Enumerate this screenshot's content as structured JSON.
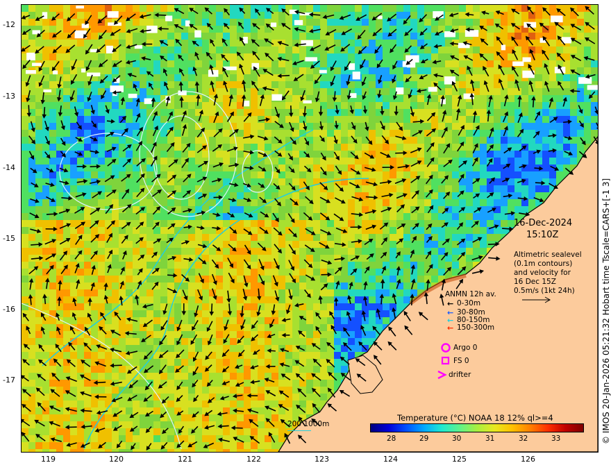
{
  "map": {
    "y_axis_labels": [
      "-12",
      "-13",
      "-14",
      "-15",
      "-16",
      "-17"
    ],
    "x_axis_labels": [
      "119",
      "120",
      "121",
      "122",
      "123",
      "124",
      "125",
      "126"
    ],
    "lat_range": [
      -17.97,
      -11.72
    ],
    "lon_range": [
      118.55,
      126.95
    ]
  },
  "overlay": {
    "date": "16-Dec-2024",
    "time": "15:10Z",
    "info_lines": [
      "Altimetric sealevel",
      "(0.1m contours)",
      "and velocity for",
      "16 Dec 15Z",
      "0.5m/s (1kt 24h)"
    ]
  },
  "anmn_legend": {
    "title": "ANMN 12h av.",
    "rows": [
      {
        "label": "0-30m",
        "color": "#000000"
      },
      {
        "label": "30-80m",
        "color": "#1a5cff"
      },
      {
        "label": "80-150m",
        "color": "#22cfe0"
      },
      {
        "label": "150-300m",
        "color": "#ff2a00"
      }
    ]
  },
  "markers": {
    "argo": "Argo 0",
    "fs": "FS 0",
    "drifter": "drifter",
    "color": "#ff00ff"
  },
  "colorbar": {
    "title": "Temperature (°C) NOAA 18 12% ql>=4",
    "labels": [
      "28",
      "29",
      "30",
      "31",
      "32",
      "33"
    ]
  },
  "bathymetry": {
    "label": "200  1000m",
    "color": "#22cfe0"
  },
  "side_credit": "© IMOS 20-Jan-2026 05:21:32 Hobart time Tscale=CARS+[-1 3]",
  "colors": {
    "land": "#fccb9c",
    "contour": "#dff4ff",
    "isobath": "#22cfe0"
  }
}
